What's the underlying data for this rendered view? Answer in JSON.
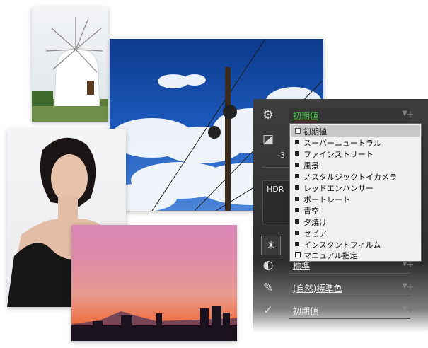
{
  "panel": {
    "picture_control": {
      "value": "初期値"
    },
    "exposure_value": "-3",
    "hdr_label": "HDR",
    "row_contrast": {
      "value": "標準"
    },
    "row_color": {
      "value": "(自然)標準色"
    },
    "row_filter": {
      "value": "初期値"
    },
    "plus_symbol": "+"
  },
  "dropdown": {
    "options": [
      {
        "label": "初期値",
        "selected": true
      },
      {
        "label": "スーパーニュートラル"
      },
      {
        "label": "ファインストリート"
      },
      {
        "label": "風景"
      },
      {
        "label": "ノスタルジックトイカメラ"
      },
      {
        "label": "レッドエンハンサー"
      },
      {
        "label": "ポートレート"
      },
      {
        "label": "青空"
      },
      {
        "label": "夕焼け"
      },
      {
        "label": "セピア"
      },
      {
        "label": "インスタントフィルム"
      },
      {
        "label": "マニュアル指定"
      }
    ]
  },
  "icons": {
    "settings": "gear-icon",
    "exposure": "exposure-icon",
    "brightness": "sun-icon",
    "contrast": "contrast-icon",
    "color": "eyedropper-icon",
    "filter": "filter-icon"
  }
}
